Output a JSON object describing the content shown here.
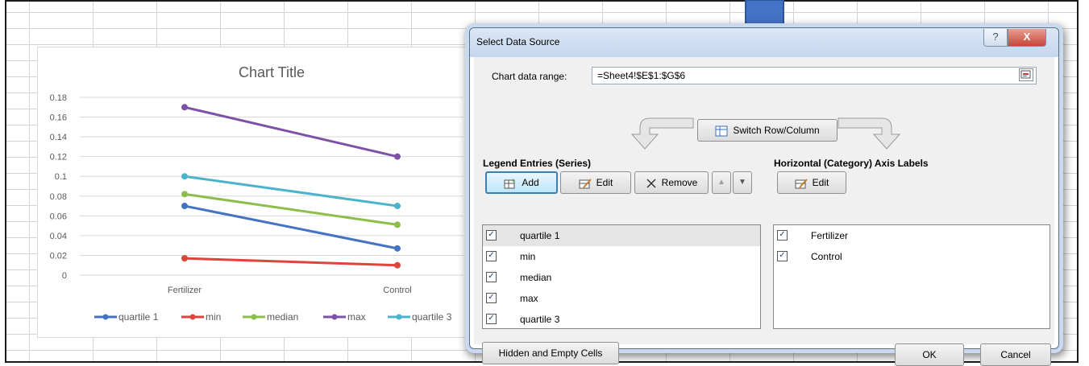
{
  "chart": {
    "title": "Chart Title",
    "y_ticks": [
      "0.18",
      "0.16",
      "0.14",
      "0.12",
      "0.1",
      "0.08",
      "0.06",
      "0.04",
      "0.02",
      "0"
    ],
    "legend_colors": {
      "quartile 1": "#4472c4",
      "min": "#e0433a",
      "median": "#8cbf4a",
      "max": "#7e51a8",
      "quartile 3": "#4bb3cc"
    }
  },
  "chart_data": {
    "type": "line",
    "title": "Chart Title",
    "categories": [
      "Fertilizer",
      "Control"
    ],
    "ylim": [
      0,
      0.18
    ],
    "grid": true,
    "legend_position": "bottom",
    "series": [
      {
        "name": "quartile 1",
        "values": [
          0.07,
          0.027
        ],
        "color": "#4472c4"
      },
      {
        "name": "min",
        "values": [
          0.017,
          0.01
        ],
        "color": "#e0433a"
      },
      {
        "name": "median",
        "values": [
          0.082,
          0.051
        ],
        "color": "#8cbf4a"
      },
      {
        "name": "max",
        "values": [
          0.17,
          0.12
        ],
        "color": "#7e51a8"
      },
      {
        "name": "quartile 3",
        "values": [
          0.1,
          0.07
        ],
        "color": "#4bb3cc"
      }
    ]
  },
  "dialog": {
    "title": "Select Data Source",
    "help_glyph": "?",
    "close_glyph": "X",
    "range_label": "Chart data range:",
    "range_value": "=Sheet4!$E$1:$G$6",
    "switch_label": "Switch Row/Column",
    "legend_header": "Legend Entries (Series)",
    "axis_header": "Horizontal (Category) Axis Labels",
    "add_label": "Add",
    "edit_label": "Edit",
    "remove_label": "Remove",
    "up_glyph": "▲",
    "down_glyph": "▼",
    "axis_edit_label": "Edit",
    "series_items": [
      "quartile 1",
      "min",
      "median",
      "max",
      "quartile 3"
    ],
    "category_items": [
      "Fertilizer",
      "Control"
    ],
    "check_glyph": "✓",
    "hidden_empty_label": "Hidden and Empty Cells",
    "ok_label": "OK",
    "cancel_label": "Cancel"
  }
}
